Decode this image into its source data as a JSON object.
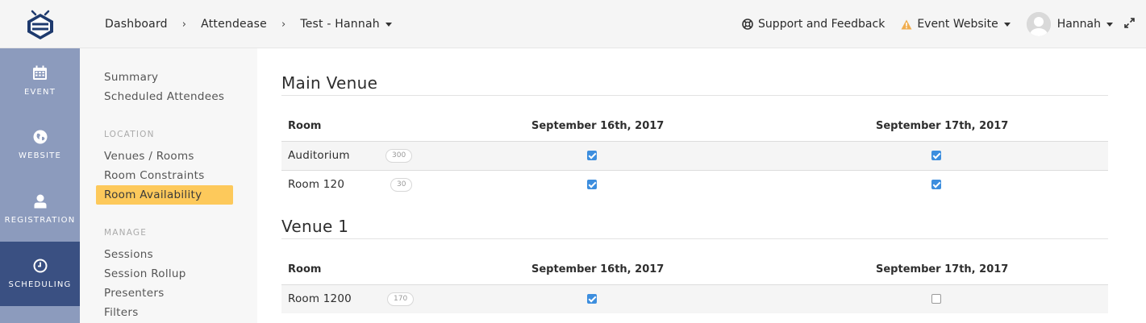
{
  "breadcrumb": {
    "dashboard": "Dashboard",
    "app": "Attendease",
    "event": "Test - Hannah"
  },
  "topbar": {
    "support": "Support and Feedback",
    "event_website": "Event Website",
    "user": "Hannah"
  },
  "leftnav": [
    {
      "label": "EVENT",
      "icon": "calendar-icon"
    },
    {
      "label": "WEBSITE",
      "icon": "globe-icon"
    },
    {
      "label": "REGISTRATION",
      "icon": "user-icon"
    },
    {
      "label": "SCHEDULING",
      "icon": "clock-icon",
      "active": true
    }
  ],
  "subnav": {
    "summary": "Summary",
    "scheduled_attendees": "Scheduled Attendees",
    "location_heading": "LOCATION",
    "venues_rooms": "Venues / Rooms",
    "room_constraints": "Room Constraints",
    "room_availability": "Room Availability",
    "manage_heading": "MANAGE",
    "sessions": "Sessions",
    "session_rollup": "Session Rollup",
    "presenters": "Presenters",
    "filters": "Filters"
  },
  "venues": [
    {
      "name": "Main Venue",
      "headers": {
        "room": "Room",
        "day1": "September 16th, 2017",
        "day2": "September 17th, 2017"
      },
      "rooms": [
        {
          "name": "Auditorium",
          "capacity": "300",
          "day1": true,
          "day2": true
        },
        {
          "name": "Room 120",
          "capacity": "30",
          "day1": true,
          "day2": true
        }
      ]
    },
    {
      "name": "Venue 1",
      "headers": {
        "room": "Room",
        "day1": "September 16th, 2017",
        "day2": "September 17th, 2017"
      },
      "rooms": [
        {
          "name": "Room 1200",
          "capacity": "170",
          "day1": true,
          "day2": false
        }
      ]
    }
  ],
  "colors": {
    "nav_bg": "#8c9bbd",
    "nav_active": "#3a5082",
    "highlight": "#fdc95b",
    "checkbox": "#3d8ede",
    "warning": "#f0ad4e"
  }
}
